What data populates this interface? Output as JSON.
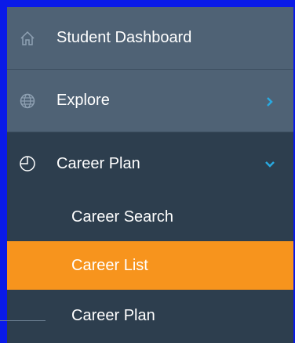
{
  "colors": {
    "frame": "#0a1ae8",
    "top_item_bg": "#4f6275",
    "nav_bg": "#2d3e4e",
    "active_bg": "#f7941d",
    "chevron": "#29a9e0"
  },
  "nav": {
    "items": [
      {
        "label": "Student Dashboard",
        "icon": "home-icon"
      },
      {
        "label": "Explore",
        "icon": "globe-icon",
        "chevron": "chevron-right-icon"
      },
      {
        "label": "Career Plan",
        "icon": "pie-chart-icon",
        "chevron": "chevron-down-icon"
      }
    ],
    "subitems": [
      {
        "label": "Career Search",
        "active": false
      },
      {
        "label": "Career List",
        "active": true
      },
      {
        "label": "Career Plan",
        "active": false
      }
    ]
  }
}
